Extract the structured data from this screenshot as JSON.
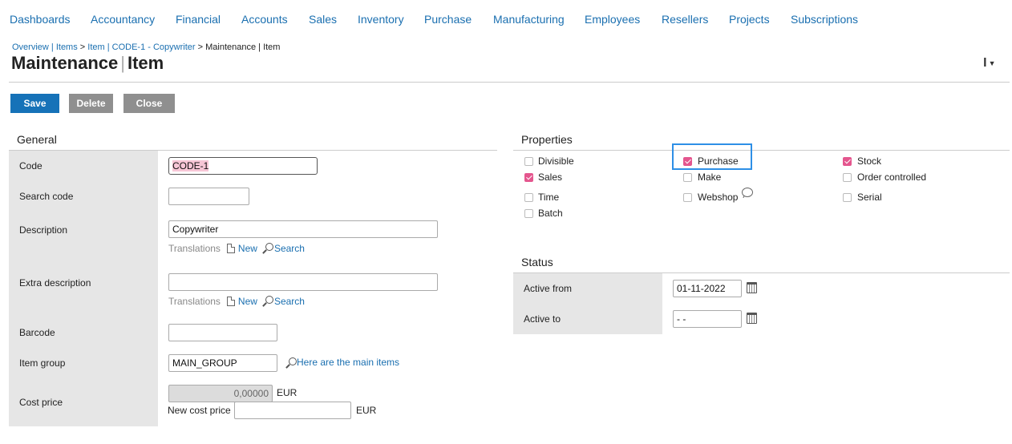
{
  "nav": {
    "items": [
      "Dashboards",
      "Accountancy",
      "Financial",
      "Accounts",
      "Sales",
      "Inventory",
      "Purchase",
      "Manufacturing",
      "Employees",
      "Resellers",
      "Projects",
      "Subscriptions"
    ]
  },
  "breadcrumb": {
    "overview": "Overview",
    "pipe": " | ",
    "items": "Items",
    "gt1": " > ",
    "item_link": "Item | CODE-1 - Copywriter",
    "gt2": " > ",
    "current": "Maintenance | Item"
  },
  "title": {
    "part1": "Maintenance",
    "sep": "|",
    "part2": "Item"
  },
  "toolbar": {
    "save": "Save",
    "delete": "Delete",
    "close": "Close"
  },
  "general": {
    "heading": "General",
    "code_label": "Code",
    "code_value": "CODE-1",
    "search_code_label": "Search code",
    "search_code_value": "",
    "description_label": "Description",
    "description_value": "Copywriter",
    "translations_label": "Translations",
    "new_label": "New",
    "search_label": "Search",
    "extra_description_label": "Extra description",
    "extra_description_value": "",
    "barcode_label": "Barcode",
    "barcode_value": "",
    "item_group_label": "Item group",
    "item_group_value": "MAIN_GROUP",
    "item_group_link": "Here are the main items",
    "cost_price_label": "Cost price",
    "cost_price_value": "0,00000",
    "currency": "EUR",
    "new_cost_price_label": "New cost price",
    "new_cost_price_value": ""
  },
  "properties": {
    "heading": "Properties",
    "items": [
      {
        "label": "Divisible",
        "checked": false
      },
      {
        "label": "Purchase",
        "checked": true
      },
      {
        "label": "Stock",
        "checked": true
      },
      {
        "label": "Sales",
        "checked": true
      },
      {
        "label": "Make",
        "checked": false
      },
      {
        "label": "Order controlled",
        "checked": false
      },
      {
        "label": "Time",
        "checked": false
      },
      {
        "label": "Webshop",
        "checked": false
      },
      {
        "label": "Serial",
        "checked": false
      },
      {
        "label": "Batch",
        "checked": false
      }
    ]
  },
  "status": {
    "heading": "Status",
    "active_from_label": "Active from",
    "active_from_value": "01-11-2022",
    "active_to_label": "Active to",
    "active_to_value": "- -"
  }
}
